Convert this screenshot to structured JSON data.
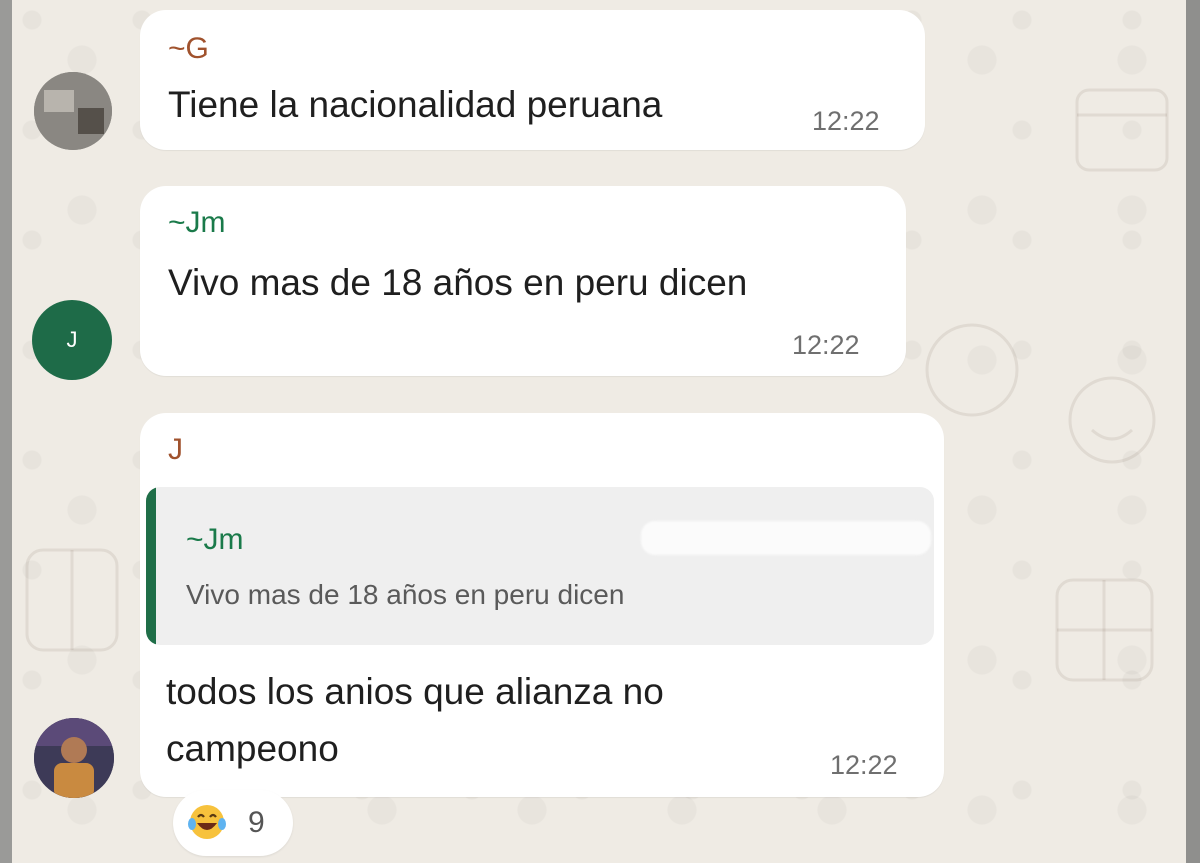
{
  "messages": [
    {
      "sender": "~G",
      "text": "Tiene la nacionalidad peruana",
      "time": "12:22"
    },
    {
      "sender": "~Jm",
      "avatar_initial": "J",
      "text": "Vivo mas de 18 años en peru dicen",
      "time": "12:22"
    },
    {
      "sender": "J",
      "quote": {
        "sender": "~Jm",
        "text": "Vivo mas de 18 años en peru dicen"
      },
      "text_line1": "todos los anios que alianza no",
      "text_line2": "campeono",
      "time": "12:22",
      "reaction": {
        "emoji": "😂",
        "count": "9"
      }
    }
  ],
  "colors": {
    "wallpaper": "#efebe4",
    "bubble": "#ffffff",
    "sender_green": "#1a7a4a",
    "sender_brown": "#a0522d",
    "quote_bar": "#1f6e48",
    "avatar_j": "#1e6b48"
  },
  "icons": {
    "reaction": "laughing-tears-emoji"
  }
}
